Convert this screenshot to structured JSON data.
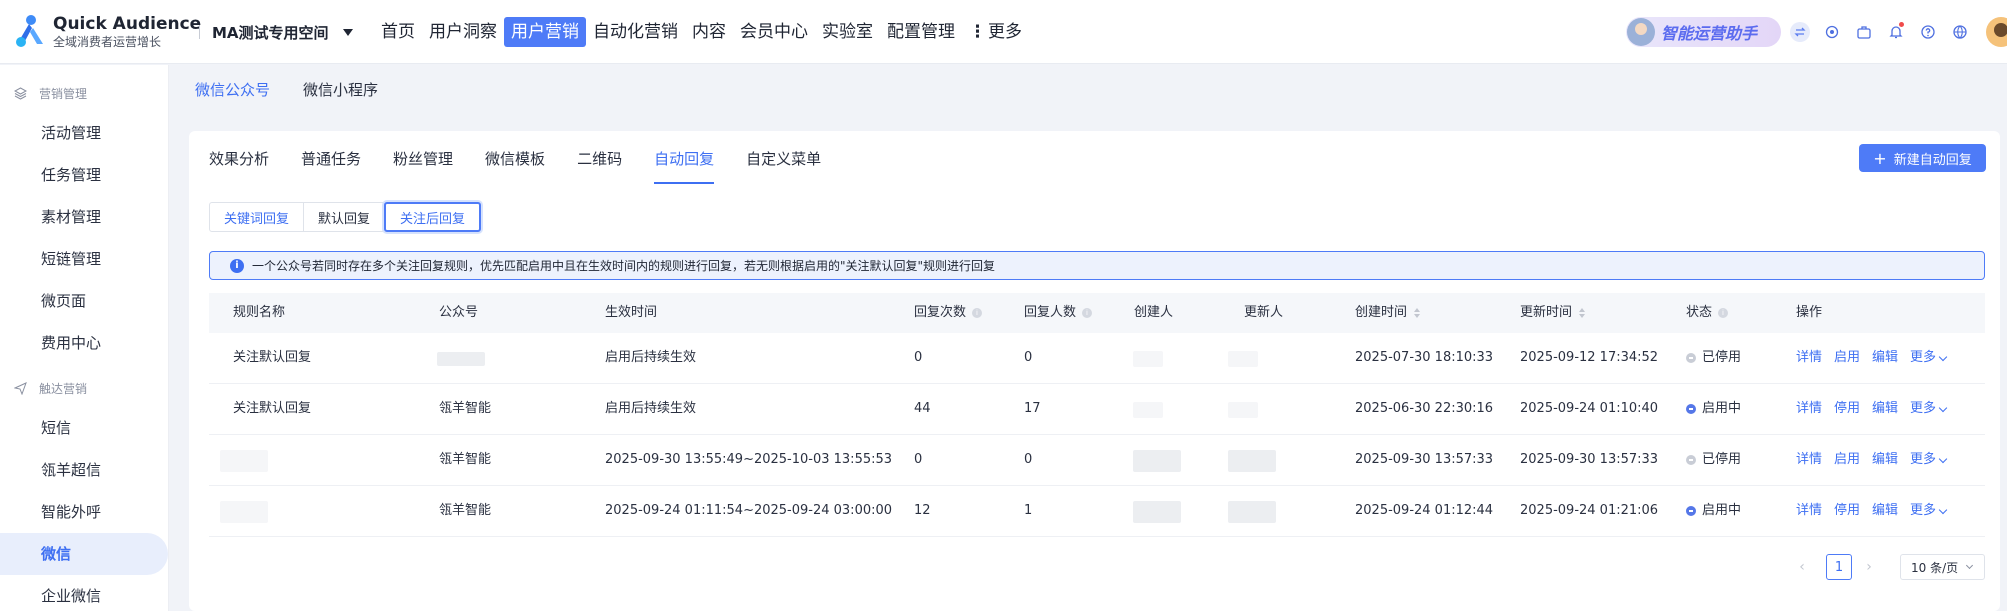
{
  "brand": {
    "name": "Quick Audience",
    "subtitle": "全域消费者运营增长"
  },
  "workspace": {
    "label": "MA测试专用空间"
  },
  "top_menu": [
    {
      "label": "首页"
    },
    {
      "label": "用户洞察"
    },
    {
      "label": "用户营销",
      "active": true
    },
    {
      "label": "自动化营销"
    },
    {
      "label": "内容"
    },
    {
      "label": "会员中心"
    },
    {
      "label": "实验室"
    },
    {
      "label": "配置管理"
    }
  ],
  "top_more": {
    "dots": "⋮",
    "label": "更多"
  },
  "assistant": {
    "label": "智能运营助手"
  },
  "sidebar": {
    "group1": "营销管理",
    "items1": [
      {
        "label": "活动管理"
      },
      {
        "label": "任务管理"
      },
      {
        "label": "素材管理"
      },
      {
        "label": "短链管理"
      },
      {
        "label": "微页面"
      },
      {
        "label": "费用中心"
      }
    ],
    "group2": "触达营销",
    "items2": [
      {
        "label": "短信"
      },
      {
        "label": "瓴羊超信"
      },
      {
        "label": "智能外呼"
      },
      {
        "label": "微信",
        "active": true
      },
      {
        "label": "企业微信"
      }
    ]
  },
  "subtabs": [
    {
      "label": "微信公众号",
      "active": true
    },
    {
      "label": "微信小程序"
    }
  ],
  "tabs": [
    {
      "label": "效果分析"
    },
    {
      "label": "普通任务"
    },
    {
      "label": "粉丝管理"
    },
    {
      "label": "微信模板"
    },
    {
      "label": "二维码"
    },
    {
      "label": "自动回复",
      "active": true
    },
    {
      "label": "自定义菜单"
    }
  ],
  "new_button": {
    "plus": "+",
    "label": "新建自动回复"
  },
  "segments": [
    {
      "label": "关键词回复"
    },
    {
      "label": "默认回复"
    },
    {
      "label": "关注后回复",
      "active": true
    }
  ],
  "notice": {
    "icon": "i",
    "text": "一个公众号若同时存在多个关注回复规则，优先匹配启用中且在生效时间内的规则进行回复，若无则根据启用的\"关注默认回复\"规则进行回复"
  },
  "table": {
    "headers": {
      "name": "规则名称",
      "account": "公众号",
      "effective": "生效时间",
      "reply_count": "回复次数",
      "reply_users": "回复人数",
      "creator": "创建人",
      "updater": "更新人",
      "created": "创建时间",
      "updated": "更新时间",
      "status": "状态",
      "ops": "操作"
    },
    "rows": [
      {
        "name": "关注默认回复",
        "account": "",
        "effective": "启用后持续生效",
        "reply_count": "0",
        "reply_users": "0",
        "created": "2025-07-30 18:10:33",
        "updated": "2025-09-12 17:34:52",
        "status": "已停用",
        "status_on": false,
        "toggle": "启用"
      },
      {
        "name": "关注默认回复",
        "account": "瓴羊智能",
        "effective": "启用后持续生效",
        "reply_count": "44",
        "reply_users": "17",
        "created": "2025-06-30 22:30:16",
        "updated": "2025-09-24 01:10:40",
        "status": "启用中",
        "status_on": true,
        "toggle": "停用"
      },
      {
        "name": "",
        "account": "瓴羊智能",
        "effective": "2025-09-30 13:55:49~2025-10-03 13:55:53",
        "reply_count": "0",
        "reply_users": "0",
        "created": "2025-09-30 13:57:33",
        "updated": "2025-09-30 13:57:33",
        "status": "已停用",
        "status_on": false,
        "toggle": "启用"
      },
      {
        "name": "",
        "account": "瓴羊智能",
        "effective": "2025-09-24 01:11:54~2025-09-24 03:00:00",
        "reply_count": "12",
        "reply_users": "1",
        "created": "2025-09-24 01:12:44",
        "updated": "2025-09-24 01:21:06",
        "status": "启用中",
        "status_on": true,
        "toggle": "停用"
      }
    ],
    "actions": {
      "detail": "详情",
      "edit": "编辑",
      "more": "更多"
    }
  },
  "pagination": {
    "prev": "‹",
    "current": "1",
    "next": "›",
    "page_size": "10 条/页"
  },
  "colors": {
    "accent": "#4e7bf7",
    "active_text": "#3e6ff2",
    "status_on": "#5577e8",
    "status_off": "#c9cdd6"
  }
}
